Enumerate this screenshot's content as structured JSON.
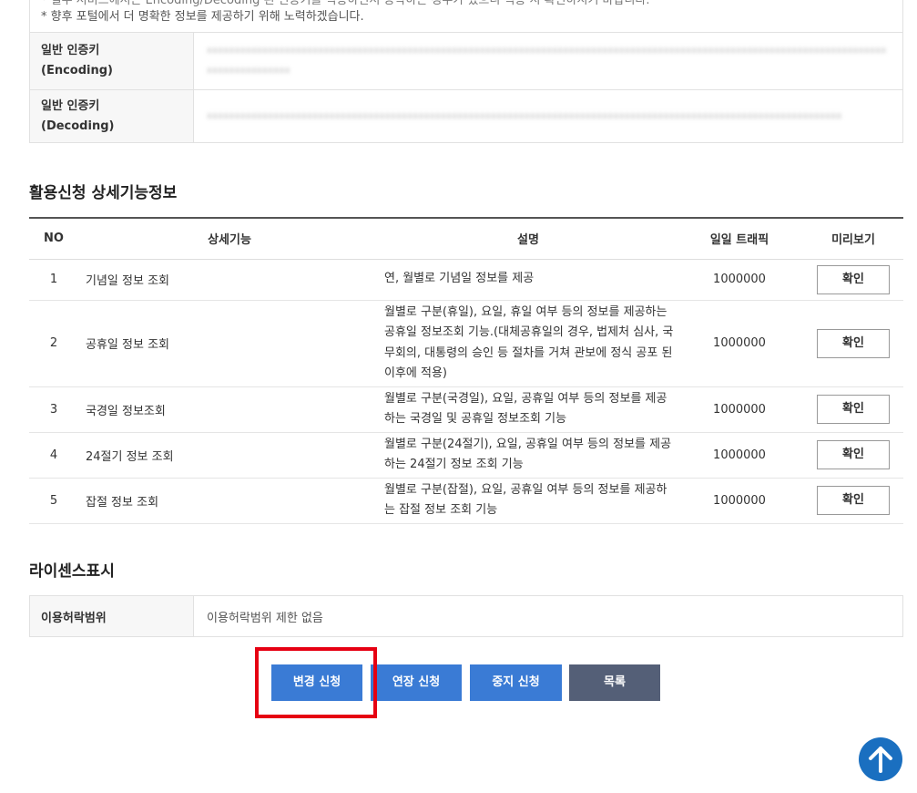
{
  "notes": {
    "line1": "* 일부 서비스에서는 Encoding/Decoding 된 인증키를 적용하면서 동작하는 경우가 있으니 적용 시 확인하시기 바랍니다.",
    "line2": "* 향후 포털에서 더 명확한 정보를 제공하기 위해 노력하겠습니다."
  },
  "keys": [
    {
      "label_line1": "일반 인증키",
      "label_line2": "(Encoding)",
      "value": "xxxxxxxxxxxxxxxxxxxxxxxxxxxxxxxxxxxxxxxxxxxxxxxxxxxxxxxxxxxxxxxxxxxxxxxxxxxxxxxxxxxxxxxxxxxxxxxxxxxxxxxxxxxxxxxxxxxxxxxxxxxxxxxxxxxxxxxxx"
    },
    {
      "label_line1": "일반 인증키",
      "label_line2": "(Decoding)",
      "value": "xxxxxxxxxxxxxxxxxxxxxxxxxxxxxxxxxxxxxxxxxxxxxxxxxxxxxxxxxxxxxxxxxxxxxxxxxxxxxxxxxxxxxxxxxxxxxxxxxxxxxxxxxxxxxxxxxx"
    }
  ],
  "func_section": {
    "title": "활용신청 상세기능정보",
    "headers": {
      "no": "NO",
      "name": "상세기능",
      "desc": "설명",
      "traffic": "일일 트래픽",
      "preview": "미리보기"
    },
    "rows": [
      {
        "no": "1",
        "name": "기념일 정보 조회",
        "desc": "연, 월별로 기념일 정보를 제공",
        "traffic": "1000000",
        "btn": "확인"
      },
      {
        "no": "2",
        "name": "공휴일 정보 조회",
        "desc": "월별로 구분(휴일), 요일, 휴일 여부 등의 정보를 제공하는 공휴일 정보조회 기능.(대체공휴일의 경우, 법제처 심사, 국무회의, 대통령의 승인 등 절차를 거쳐 관보에 정식 공포 된 이후에 적용)",
        "traffic": "1000000",
        "btn": "확인"
      },
      {
        "no": "3",
        "name": "국경일 정보조회",
        "desc": "월별로 구분(국경일), 요일, 공휴일 여부 등의 정보를 제공하는 국경일 및 공휴일 정보조회 기능",
        "traffic": "1000000",
        "btn": "확인"
      },
      {
        "no": "4",
        "name": "24절기 정보 조회",
        "desc": "월별로 구분(24절기), 요일, 공휴일 여부 등의 정보를 제공하는 24절기 정보 조회 기능",
        "traffic": "1000000",
        "btn": "확인"
      },
      {
        "no": "5",
        "name": "잡절 정보 조회",
        "desc": "월별로 구분(잡절), 요일, 공휴일 여부 등의 정보를 제공하는 잡절 정보 조회 기능",
        "traffic": "1000000",
        "btn": "확인"
      }
    ]
  },
  "license": {
    "title": "라이센스표시",
    "label": "이용허락범위",
    "value": "이용허락범위 제한 없음"
  },
  "actions": {
    "change": "변경 신청",
    "extend": "연장 신청",
    "stop": "중지 신청",
    "list": "목록"
  },
  "colors": {
    "primary_button": "#3a7bd5",
    "list_button": "#545f77",
    "highlight_box": "#e60012",
    "top_button": "#1a6fc0"
  },
  "icons": {
    "top_button": "arrow-up-icon"
  }
}
